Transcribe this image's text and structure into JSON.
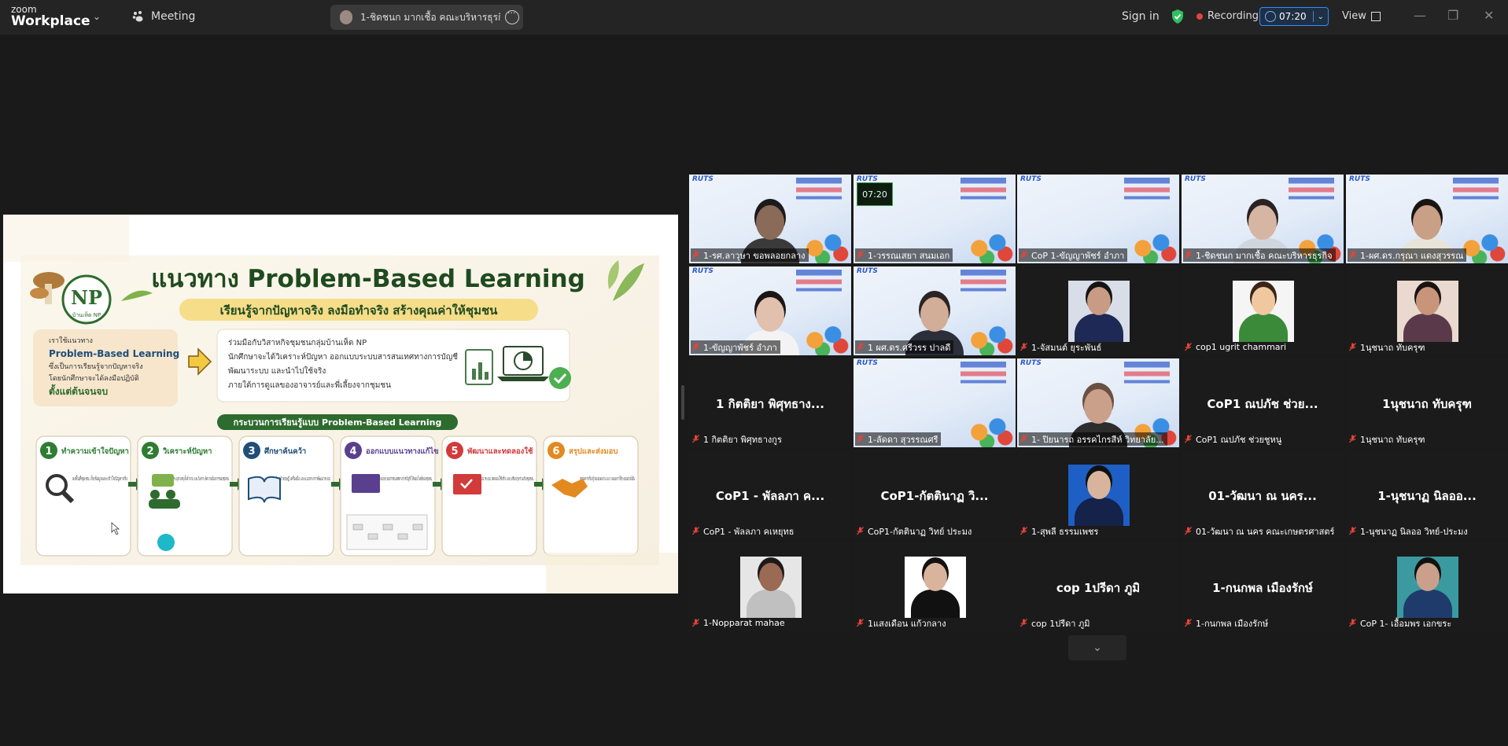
{
  "topbar": {
    "logo_line1": "zoom",
    "logo_line2": "Workplace",
    "meeting_label": "Meeting",
    "active_speaker": "1-ชิดชนก มากเชื้อ คณะบริหารธุรกิจ's screen",
    "sign_in": "Sign in",
    "recording_label": "Recording",
    "timer": "07:20",
    "view_label": "View"
  },
  "slide": {
    "title": "แนวทาง Problem-Based Learning",
    "subtitle": "เรียนรู้จากปัญหาจริง ลงมือทำจริง สร้างคุณค่าให้ชุมชน",
    "logo_text": "NP",
    "logo_caption": "บ้านเห็ด NP",
    "left_box": [
      "เราใช้แนวทาง",
      "Problem-Based Learning",
      "ซึ่งเป็นการเรียนรู้จากปัญหาจริง",
      "โดยนักศึกษาจะได้ลงมือปฏิบัติ",
      "ตั้งแต่ต้นจนจบ"
    ],
    "right_box": [
      "ร่วมมือกับวิสาหกิจชุมชนกลุ่มบ้านเห็ด NP",
      "นักศึกษาจะได้วิเคราะห์ปัญหา ออกแบบระบบสารสนเทศทางการบัญชี",
      "พัฒนาระบบ และนำไปใช้จริง",
      "ภายใต้การดูแลของอาจารย์และพี่เลี้ยงจากชุมชน"
    ],
    "process_title": "กระบวนการเรียนรู้แบบ Problem-Based Learning",
    "steps": [
      {
        "num": "1",
        "title": "ทำความเข้าใจปัญหา",
        "desc": "ลงพื้นที่ชุมชน เก็บข้อมูลและเข้าใจปัญหาจริง",
        "color": "#2e7d32"
      },
      {
        "num": "2",
        "title": "วิเคราะห์ปัญหา",
        "desc": "ระบุสาเหตุ ตั้งคำถาม และวิเคราะห์ความต้องการของชุมชน",
        "color": "#2e7d32"
      },
      {
        "num": "3",
        "title": "ศึกษาค้นคว้า",
        "desc": "ค้นคว้าทฤษฎี เครื่องมือ และแนวทางการพัฒนาระบบ",
        "color": "#1f4e79"
      },
      {
        "num": "4",
        "title": "ออกแบบแนวทางแก้ไข",
        "desc": "ออกแบบระบบสารสนเทศทางการบัญชี ให้ตอบโจทย์ของชุมชน",
        "color": "#5b3f8f"
      },
      {
        "num": "5",
        "title": "พัฒนาและทดลองใช้",
        "desc": "พัฒนาระบบ ทดลองใช้จริง และปรับปรุงร่วมกับชุมชน",
        "color": "#d33a3a"
      },
      {
        "num": "6",
        "title": "สรุปและส่งมอบ",
        "desc": "สรุปผลการเรียนรู้ ส่งมอบผลงาน และวางแผนการใช้ระบบอย่างยั่งยืน",
        "color": "#e28a1f"
      }
    ]
  },
  "tiles": [
    {
      "label": "1-รศ.ลาวุษา ขอพลอยกลาง",
      "kind": "video",
      "skin": "#8a6a58",
      "shirt": "#3a3a3a",
      "hair": "#1c1a1a"
    },
    {
      "label": "1-วรรณเสยา สนมเอก",
      "kind": "video-empty",
      "clock": "07:20"
    },
    {
      "label": "CoP 1-ขัญญาพัชร์ อำภา",
      "kind": "video-empty"
    },
    {
      "label": "1-ชิดชนก มากเชื้อ คณะบริหารธุรกิจ",
      "kind": "video",
      "skin": "#d6b5a3",
      "shirt": "#cfd6de",
      "hair": "#2a2222",
      "active": true
    },
    {
      "label": "1-ผศ.ดร.กรุณา แดงสุวรรณ",
      "kind": "video",
      "skin": "#c99f86",
      "shirt": "#e9e4da",
      "hair": "#181414"
    },
    {
      "label": "1-ขัญญาพัชร์ อำภา",
      "kind": "video",
      "skin": "#e1c0ad",
      "shirt": "#f3f3f3",
      "hair": "#1a1616"
    },
    {
      "label": "1 ผศ.ดร.ศรีวรร ปาลดี",
      "kind": "video",
      "skin": "#d2ad98",
      "shirt": "#2c2f3a",
      "hair": "#2a2424"
    },
    {
      "label": "1-จัสมนต์ ยุระพันธ์",
      "kind": "photo",
      "skin": "#c89b84",
      "shirt": "#1e2a55",
      "bg": "#d8dde8",
      "hair": "#141414"
    },
    {
      "label": "cop1 ugrit chammari",
      "kind": "photo",
      "skin": "#f0c8a0",
      "shirt": "#3a8a3a",
      "bg": "#f5f5f5",
      "hair": "#3b2416"
    },
    {
      "label": "1นุชนาถ ทับครุฑ",
      "kind": "photo",
      "skin": "#c8957a",
      "shirt": "#5a3a4a",
      "bg": "#e9d9cf",
      "hair": "#1a1212"
    },
    {
      "label": "1 กิตติยา พิศุทธางกูร",
      "kind": "name",
      "big": "1 กิตติยา พิศุทธาง..."
    },
    {
      "label": "1-ลัดดา สุวรรณศรี",
      "kind": "video-empty"
    },
    {
      "label": "1- ปิยนารถ อรรคไกรสีห์ วิทยาลัย...",
      "kind": "video",
      "skin": "#caa08a",
      "shirt": "#2d2d2d",
      "hair": "#6a5040"
    },
    {
      "label": "CoP1 ณปภัช ช่วยชูหนู",
      "kind": "name",
      "big": "CoP1 ณปภัช ช่วย..."
    },
    {
      "label": "1นุชนาถ ทับครุฑ",
      "kind": "name",
      "big": "1นุชนาถ ทับครุฑ"
    },
    {
      "label": "CoP1 - พัลลภา คเหยุทธ",
      "kind": "name",
      "big": "CoP1 - พัลลภา ค..."
    },
    {
      "label": "CoP1-กัตตินาฏ วิทย์ ประมง",
      "kind": "name",
      "big": "CoP1-กัตตินาฏ วิ..."
    },
    {
      "label": "1-สุพลี ธรรมเพชร",
      "kind": "photo",
      "skin": "#d8b49d",
      "shirt": "#15224a",
      "bg": "#1d5fc5",
      "hair": "#101010"
    },
    {
      "label": "01-วัฒนา ณ นคร คณะเกษตรศาสตร์",
      "kind": "name",
      "big": "01-วัฒนา ณ นคร..."
    },
    {
      "label": "1-นุชนาฏ นิลออ วิทย์-ประมง",
      "kind": "name",
      "big": "1-นุชนาฏ นิลออ..."
    },
    {
      "label": "1-Nopparat mahae",
      "kind": "photo",
      "skin": "#9a6a54",
      "shirt": "#c0c0c0",
      "bg": "#e6e6e6",
      "hair": "#1e1a1a"
    },
    {
      "label": "1แสงเดือน แก้วกลาง",
      "kind": "photo",
      "skin": "#d9b39b",
      "shirt": "#111111",
      "bg": "#ffffff",
      "hair": "#141010"
    },
    {
      "label": "cop 1ปรีดา ภูมิ",
      "kind": "name",
      "big": "cop 1ปรีดา ภูมิ"
    },
    {
      "label": "1-กนกพล เมืองรักษ์",
      "kind": "name",
      "big": "1-กนกพล เมืองรักษ์"
    },
    {
      "label": "CoP 1- เอื้อมพร เอกขระ",
      "kind": "photo",
      "skin": "#caa08a",
      "shirt": "#1e3b6b",
      "bg": "#3a9aa0",
      "hair": "#111111"
    }
  ]
}
